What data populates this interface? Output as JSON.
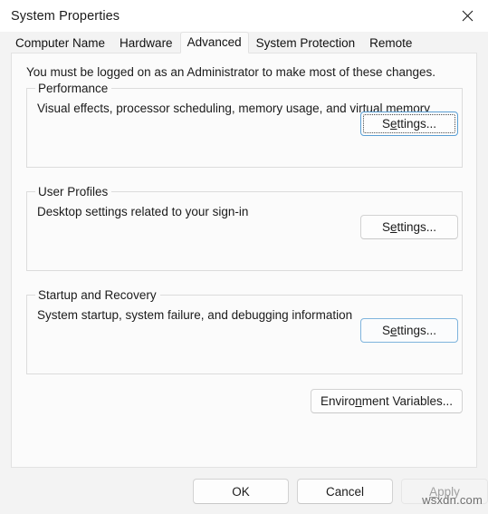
{
  "window": {
    "title": "System Properties",
    "close_icon": "close-icon"
  },
  "tabs": [
    {
      "label": "Computer Name",
      "selected": false
    },
    {
      "label": "Hardware",
      "selected": false
    },
    {
      "label": "Advanced",
      "selected": true
    },
    {
      "label": "System Protection",
      "selected": false
    },
    {
      "label": "Remote",
      "selected": false
    }
  ],
  "panel": {
    "admin_note": "You must be logged on as an Administrator to make most of these changes.",
    "groups": [
      {
        "label": "Performance",
        "description": "Visual effects, processor scheduling, memory usage, and virtual memory",
        "button": {
          "prefix": "S",
          "accel": "e",
          "suffix": "ttings...",
          "state": "focused"
        }
      },
      {
        "label": "User Profiles",
        "description": "Desktop settings related to your sign-in",
        "button": {
          "prefix": "S",
          "accel": "e",
          "suffix": "ttings...",
          "state": "normal"
        }
      },
      {
        "label": "Startup and Recovery",
        "description": "System startup, system failure, and debugging information",
        "button": {
          "prefix": "S",
          "accel": "e",
          "suffix": "ttings...",
          "state": "hovered"
        }
      }
    ],
    "environment_variables_button": {
      "prefix": "Enviro",
      "accel": "n",
      "suffix": "ment Variables..."
    }
  },
  "footer": {
    "ok_label": "OK",
    "cancel_label": "Cancel",
    "apply": {
      "accel": "A",
      "suffix": "pply",
      "enabled": false
    }
  },
  "watermark": "wsxdn.com",
  "colors": {
    "accent_focus_border": "#5a9fd4",
    "accent_hover_border": "#7fb4dd",
    "dialog_background": "#f3f3f3",
    "panel_background": "#fbfbfb",
    "text": "#1b1b1b",
    "disabled_text": "#a0a0a0"
  }
}
